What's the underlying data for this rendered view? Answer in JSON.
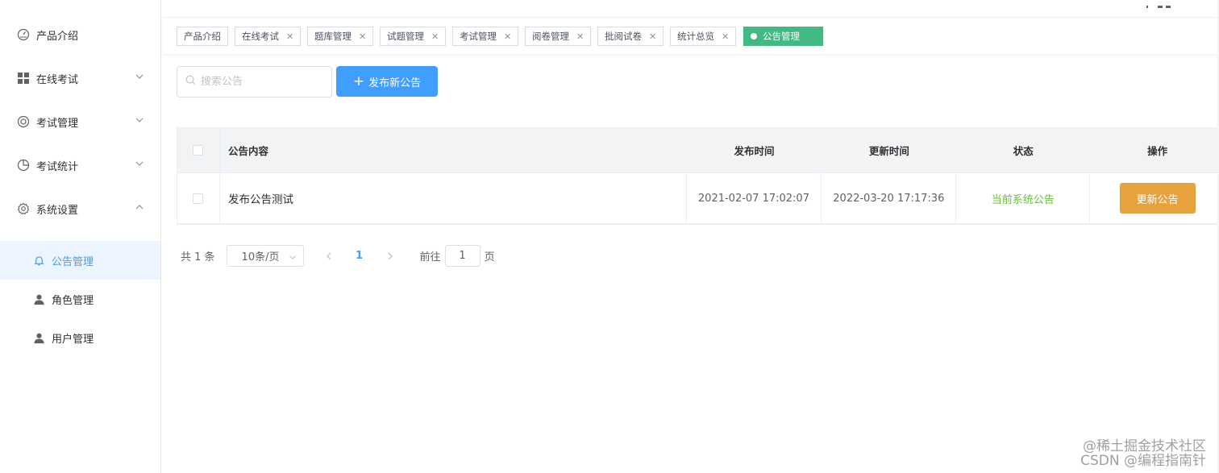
{
  "sidebar": {
    "items": [
      {
        "label": "产品介绍",
        "icon": "dashboard-icon",
        "expandable": false
      },
      {
        "label": "在线考试",
        "icon": "grid-icon",
        "expandable": true,
        "expanded": false
      },
      {
        "label": "考试管理",
        "icon": "lifebuoy-icon",
        "expandable": true,
        "expanded": false
      },
      {
        "label": "考试统计",
        "icon": "pie-chart-icon",
        "expandable": true,
        "expanded": false
      },
      {
        "label": "系统设置",
        "icon": "gear-icon",
        "expandable": true,
        "expanded": true
      }
    ],
    "sub_items": [
      {
        "label": "公告管理",
        "icon": "bell-icon",
        "active": true
      },
      {
        "label": "角色管理",
        "icon": "user-icon",
        "active": false
      },
      {
        "label": "用户管理",
        "icon": "user-icon",
        "active": false
      }
    ]
  },
  "tags": [
    {
      "label": "产品介绍",
      "closable": false,
      "active": false
    },
    {
      "label": "在线考试",
      "closable": true,
      "active": false
    },
    {
      "label": "题库管理",
      "closable": true,
      "active": false
    },
    {
      "label": "试题管理",
      "closable": true,
      "active": false
    },
    {
      "label": "考试管理",
      "closable": true,
      "active": false
    },
    {
      "label": "阅卷管理",
      "closable": true,
      "active": false
    },
    {
      "label": "批阅试卷",
      "closable": true,
      "active": false
    },
    {
      "label": "统计总览",
      "closable": true,
      "active": false
    },
    {
      "label": "公告管理",
      "closable": false,
      "active": true
    }
  ],
  "toolbar": {
    "search_placeholder": "搜索公告",
    "search_value": "",
    "publish_label": "发布新公告"
  },
  "table": {
    "headers": {
      "content": "公告内容",
      "publish_time": "发布时间",
      "update_time": "更新时间",
      "status": "状态",
      "actions": "操作"
    },
    "rows": [
      {
        "content": "发布公告测试",
        "publish_time": "2021-02-07 17:02:07",
        "update_time": "2022-03-20 17:17:36",
        "status": "当前系统公告",
        "action_label": "更新公告"
      }
    ]
  },
  "pagination": {
    "total_text": "共 1 条",
    "page_size": "10条/页",
    "current_page": "1",
    "goto_prefix": "前往",
    "goto_value": "1",
    "goto_suffix": "页"
  },
  "watermark": {
    "line1": "@稀土掘金技术社区",
    "line2": "CSDN @编程指南针"
  },
  "colors": {
    "primary": "#409eff",
    "success": "#67c23a",
    "warning": "#e6a23c",
    "active_tag": "#42b983",
    "active_menu_bg": "#ecf5ff"
  }
}
